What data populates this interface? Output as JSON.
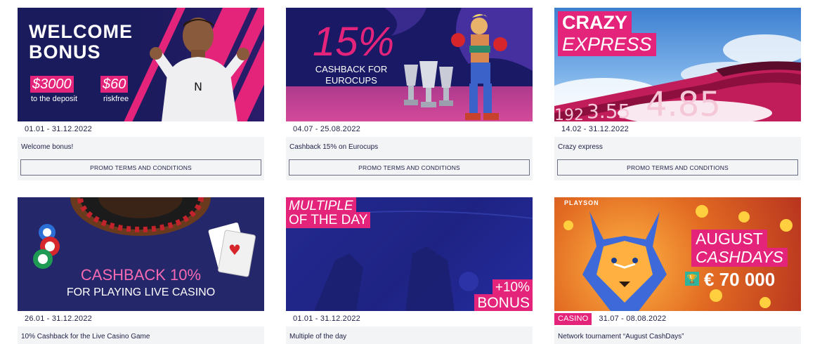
{
  "colors": {
    "accent": "#e4237b",
    "card_bg": "#f3f4f6",
    "text": "#1d2046"
  },
  "terms_label": "PROMO TERMS AND CONDITIONS",
  "promos": [
    {
      "dates": "01.01 - 31.12.2022",
      "title": "Welcome bonus!",
      "banner": {
        "headline_1": "WELCOME",
        "headline_2": "BONUS",
        "amount_1": "$3000",
        "amount_1_sub": "to the deposit",
        "amount_2": "$60",
        "amount_2_sub": "riskfree"
      }
    },
    {
      "dates": "04.07 - 25.08.2022",
      "title": "Cashback 15% on Eurocups",
      "banner": {
        "percent": "15%",
        "line_1": "CASHBACK FOR",
        "line_2": "EUROCUPS"
      }
    },
    {
      "dates": "14.02 - 31.12.2022",
      "title": "Crazy express",
      "banner": {
        "line_1": "CRAZY",
        "line_2": "EXPRESS",
        "odds": [
          "192",
          "3.55",
          "4.85"
        ]
      }
    },
    {
      "dates": "26.01 - 31.12.2022",
      "title": "10% Cashback for the Live Casino Game",
      "banner": {
        "line_1": "CASHBACK 10%",
        "line_2": "FOR PLAYING LIVE CASINO"
      }
    },
    {
      "dates": "01.01 - 31.12.2022",
      "title": "Multiple of the day",
      "banner": {
        "line_1": "MULTIPLE",
        "line_2": "OF THE DAY",
        "bonus_1": "+10%",
        "bonus_2": "BONUS"
      }
    },
    {
      "badge": "CASINO",
      "dates": "31.07 - 08.08.2022",
      "title": "Network tournament “August CashDays”",
      "banner": {
        "brand": "PLAYSON",
        "line_1": "AUGUST",
        "line_2": "CASHDAYS",
        "prize": "€ 70 000"
      }
    }
  ]
}
